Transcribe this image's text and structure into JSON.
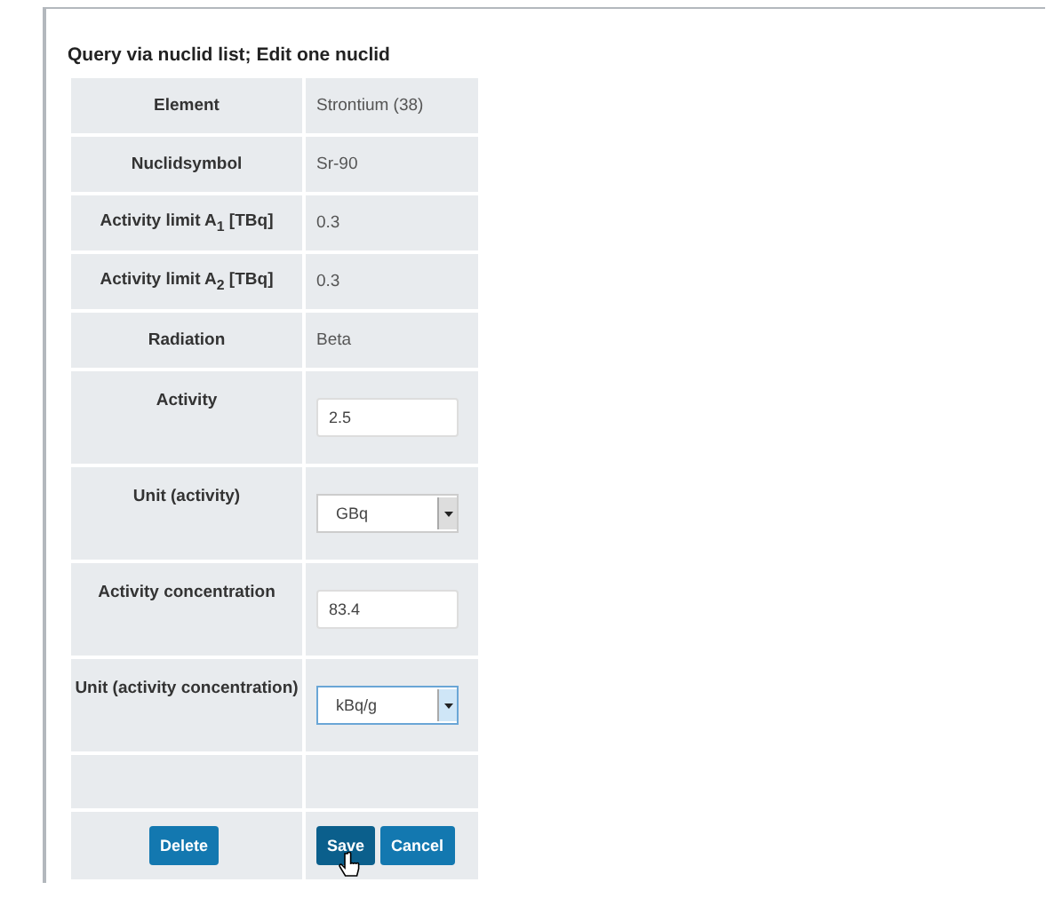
{
  "panel": {
    "title": "Query via nuclid list; Edit one nuclid"
  },
  "rows": [
    {
      "kind": "text",
      "label": "Element",
      "value": "Strontium (38)"
    },
    {
      "kind": "text",
      "label": "Nuclidsymbol",
      "value": "Sr-90"
    },
    {
      "kind": "text",
      "label": "Activity limit A$_{1}$ [TBq]",
      "value": "0.3"
    },
    {
      "kind": "text",
      "label": "Activity limit A$_{2}$ [TBq]",
      "value": "0.3"
    },
    {
      "kind": "text",
      "label": "Radiation",
      "value": "Beta"
    },
    {
      "kind": "input",
      "label": "Activity",
      "value": "2.5"
    },
    {
      "kind": "select",
      "label": "Unit (activity)",
      "value": "GBq",
      "focused": false
    },
    {
      "kind": "input",
      "label": "Activity concentration",
      "value": "83.4"
    },
    {
      "kind": "select",
      "label": "Unit (activity concentration)",
      "value": "kBq/g",
      "focused": true
    },
    {
      "kind": "empty"
    }
  ],
  "actions": {
    "left": [
      {
        "label": "Delete",
        "hovered": false
      }
    ],
    "right": [
      {
        "label": "Save",
        "hovered": true
      },
      {
        "label": "Cancel",
        "hovered": false
      }
    ]
  }
}
